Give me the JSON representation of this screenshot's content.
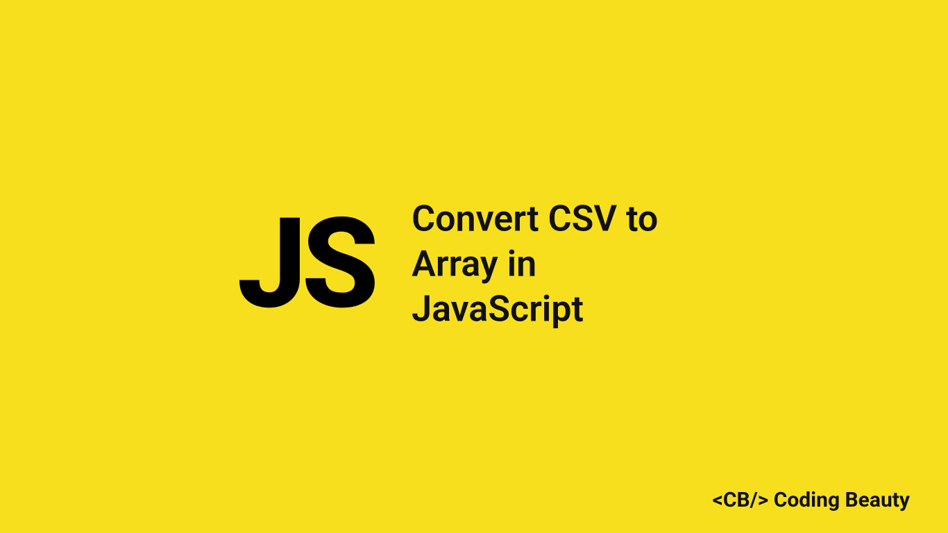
{
  "logo": {
    "text": "JS"
  },
  "title": "Convert CSV to Array in JavaScript",
  "brand": "<CB/> Coding Beauty",
  "colors": {
    "background": "#f7df1e",
    "text": "#000000"
  }
}
